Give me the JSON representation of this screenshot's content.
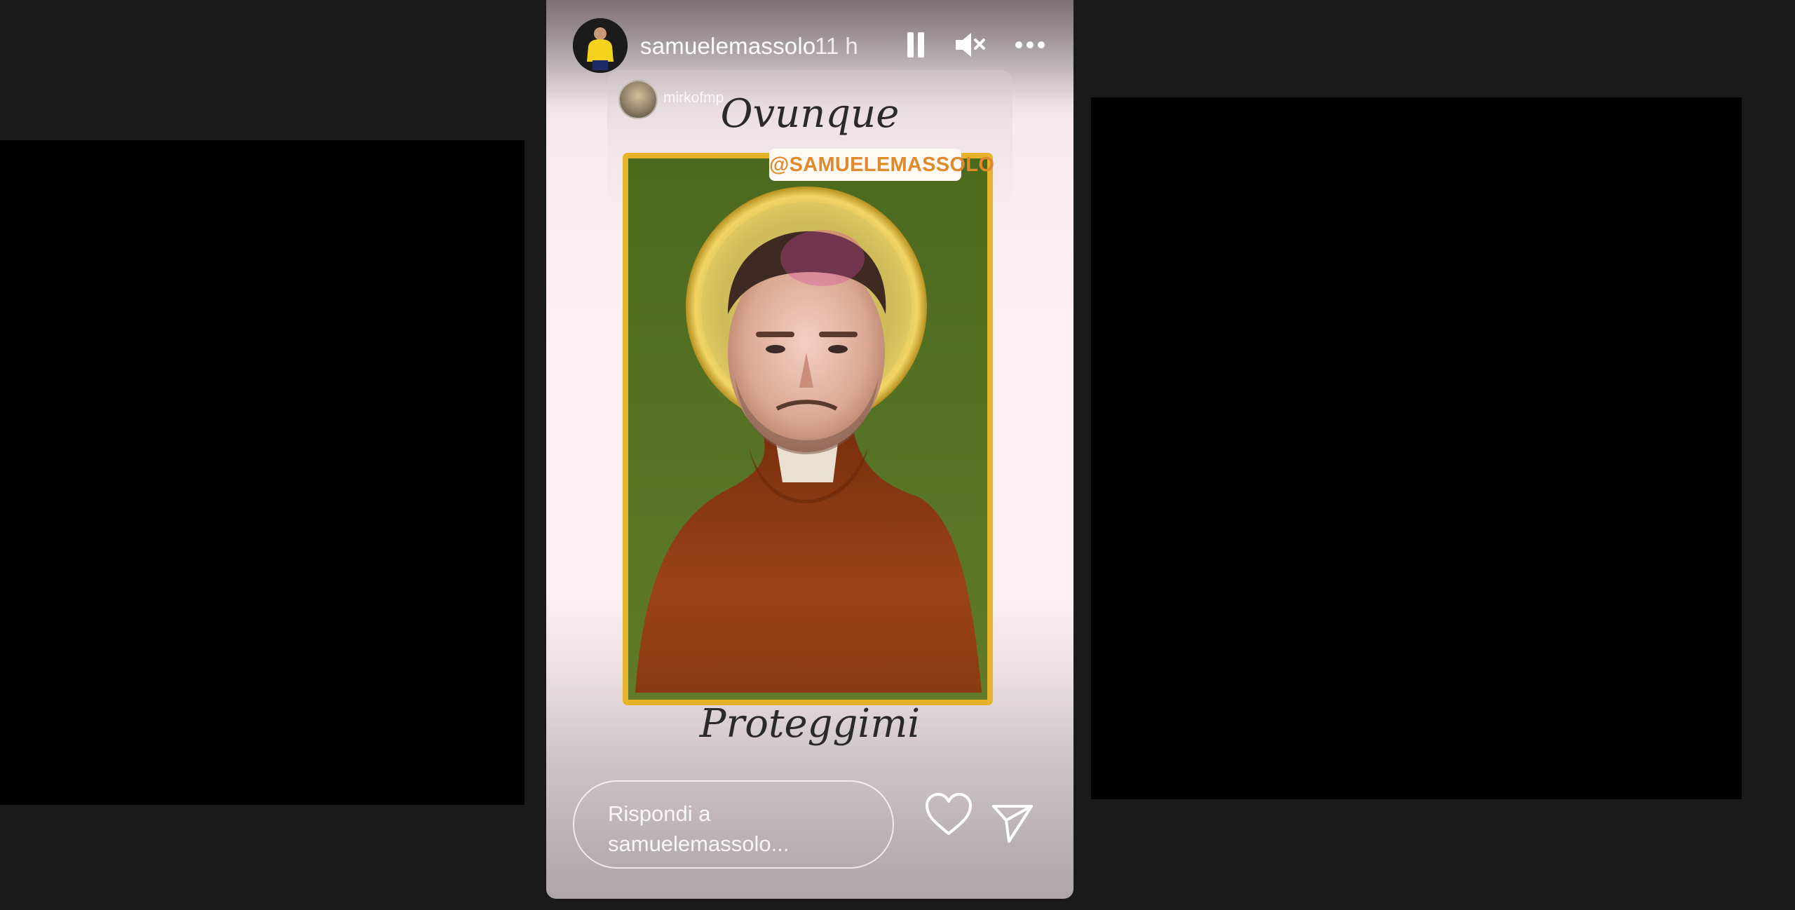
{
  "story": {
    "username": "samuelemassolo",
    "timestamp": "11 h",
    "controls": {
      "pause_icon": "pause-icon",
      "mute_icon": "speaker-muted-icon",
      "more_icon": "more-options-icon"
    }
  },
  "shared_post": {
    "author": "mirkofmp",
    "caption_top": "Ovunque",
    "mention": "@SAMUELEMASSOLO",
    "caption_bottom": "Proteggimi"
  },
  "reply": {
    "placeholder": "Rispondi a samuelemassolo..."
  },
  "actions": {
    "like_icon": "heart-icon",
    "share_icon": "paper-plane-icon"
  },
  "colors": {
    "page_background": "#1a1a1a",
    "mention_text": "#e08a2c",
    "frame_gold": "#e6b22a",
    "icon_green": "#4f6b20",
    "robe_brown": "#8b3a14"
  }
}
